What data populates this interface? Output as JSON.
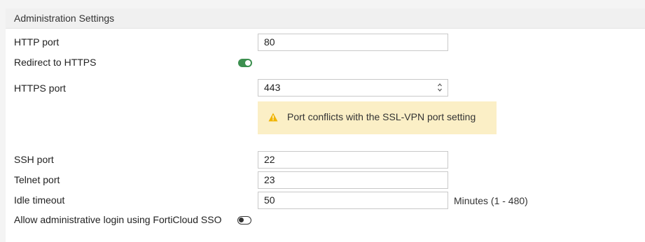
{
  "section": {
    "title": "Administration Settings"
  },
  "http_port": {
    "label": "HTTP port",
    "value": "80"
  },
  "redirect_https": {
    "label": "Redirect to HTTPS",
    "enabled": true
  },
  "https_port": {
    "label": "HTTPS port",
    "value": "443"
  },
  "warning": {
    "text": "Port conflicts with the SSL-VPN port setting",
    "icon": "warning-triangle-icon"
  },
  "ssh_port": {
    "label": "SSH port",
    "value": "22"
  },
  "telnet_port": {
    "label": "Telnet port",
    "value": "23"
  },
  "idle_timeout": {
    "label": "Idle timeout",
    "value": "50",
    "suffix": "Minutes (1 - 480)"
  },
  "forticloud_sso": {
    "label": "Allow administrative login using FortiCloud SSO",
    "enabled": false
  },
  "colors": {
    "toggle_on": "#3c8f4f",
    "warning_bg": "#fbefc6",
    "warning_icon": "#f0b400"
  }
}
